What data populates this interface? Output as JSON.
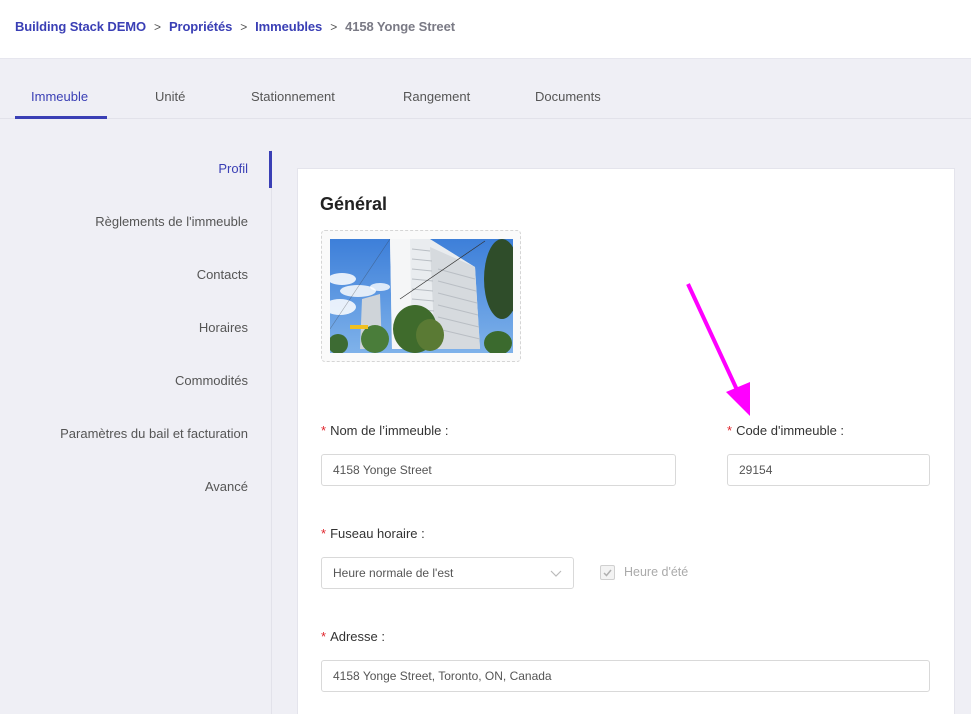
{
  "breadcrumb": {
    "items": [
      "Building Stack DEMO",
      "Propriétés",
      "Immeubles"
    ],
    "separator": ">",
    "current": "4158 Yonge Street"
  },
  "tabs": [
    {
      "label": "Immeuble",
      "active": true
    },
    {
      "label": "Unité",
      "active": false
    },
    {
      "label": "Stationnement",
      "active": false
    },
    {
      "label": "Rangement",
      "active": false
    },
    {
      "label": "Documents",
      "active": false
    }
  ],
  "sidenav": {
    "items": [
      {
        "label": "Profil",
        "active": true
      },
      {
        "label": "Règlements de l'immeuble",
        "active": false
      },
      {
        "label": "Contacts",
        "active": false
      },
      {
        "label": "Horaires",
        "active": false
      },
      {
        "label": "Commodités",
        "active": false
      },
      {
        "label": "Paramètres du bail et facturation",
        "active": false
      },
      {
        "label": "Avancé",
        "active": false
      }
    ]
  },
  "form": {
    "section_title": "Général",
    "photo_alt": "Building photo",
    "required_mark": "*",
    "building_name": {
      "label": "Nom de l’immeuble :",
      "value": "4158 Yonge Street"
    },
    "building_code": {
      "label": "Code d'immeuble :",
      "value": "29154"
    },
    "timezone": {
      "label": "Fuseau horaire :",
      "value": "Heure normale de l'est"
    },
    "dst": {
      "label": "Heure d'été",
      "checked": true,
      "disabled": true
    },
    "address": {
      "label": "Adresse :",
      "value": "4158 Yonge Street, Toronto, ON, Canada"
    }
  },
  "colors": {
    "accent": "#3a3fb5",
    "required": "#e0242b",
    "annotation_arrow": "#ff00ff"
  }
}
